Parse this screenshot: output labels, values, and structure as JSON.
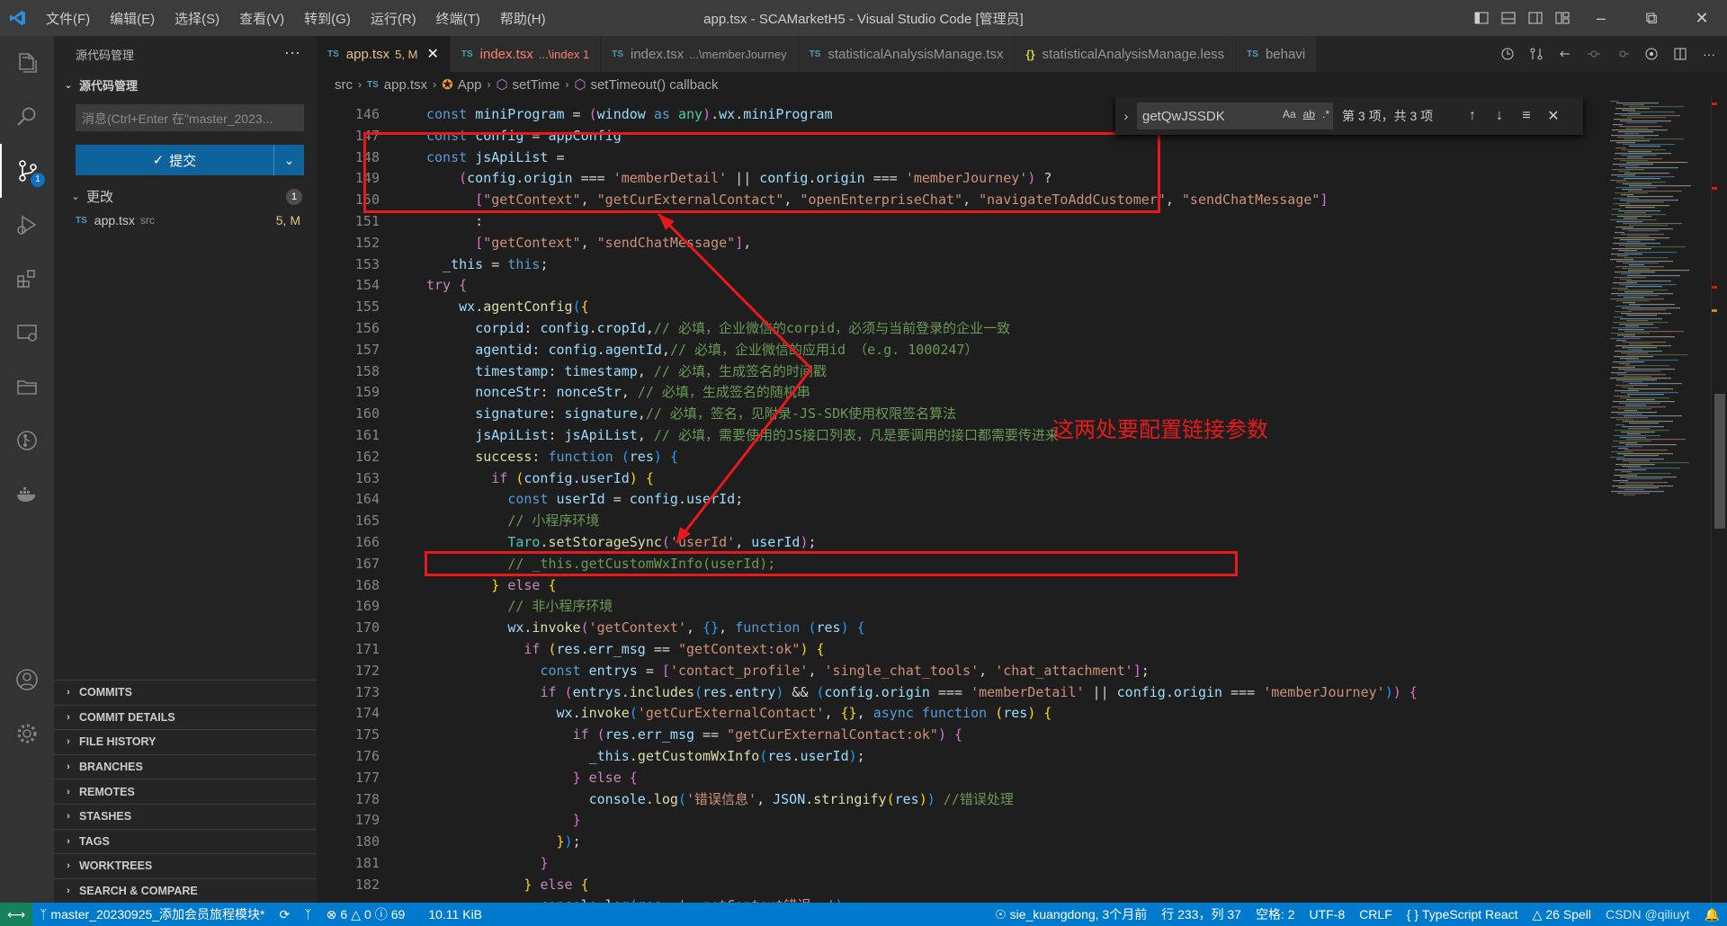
{
  "titlebar": {
    "menu": [
      "文件(F)",
      "编辑(E)",
      "选择(S)",
      "查看(V)",
      "转到(G)",
      "运行(R)",
      "终端(T)",
      "帮助(H)"
    ],
    "title": "app.tsx - SCAMarketH5 - Visual Studio Code [管理员]"
  },
  "activitybar": {
    "icons": [
      "explorer-icon",
      "search-icon",
      "source-control-icon",
      "run-debug-icon",
      "extensions-icon",
      "remote-explorer-icon",
      "folder-icon",
      "git-graph-icon",
      "docker-icon",
      "account-icon",
      "settings-gear-icon"
    ],
    "scm_badge": "1"
  },
  "sidebar": {
    "header": "源代码管理",
    "section": "源代码管理",
    "message_placeholder": "消息(Ctrl+Enter 在\"master_2023...",
    "commit_label": "提交",
    "changes_label": "更改",
    "changes_count": "1",
    "file": {
      "name": "app.tsx",
      "dir": "src",
      "status": "5, M"
    },
    "bottom_sections": [
      "COMMITS",
      "COMMIT DETAILS",
      "FILE HISTORY",
      "BRANCHES",
      "REMOTES",
      "STASHES",
      "TAGS",
      "WORKTREES",
      "SEARCH & COMPARE"
    ]
  },
  "tabs": [
    {
      "icon": "TS",
      "label": "app.tsx",
      "decoration": "5, M",
      "active": true
    },
    {
      "icon": "TS",
      "label": "index.tsx",
      "decoration": "...\\index 1",
      "error": true
    },
    {
      "icon": "TS",
      "label": "index.tsx",
      "decoration": "...\\memberJourney"
    },
    {
      "icon": "TS",
      "label": "statisticalAnalysisManage.tsx",
      "decoration": ""
    },
    {
      "icon": "{}",
      "label": "statisticalAnalysisManage.less",
      "decoration": ""
    },
    {
      "icon": "TS",
      "label": "behavi",
      "decoration": ""
    }
  ],
  "breadcrumb": [
    "src",
    "app.tsx",
    "App",
    "setTime",
    "setTimeout() callback"
  ],
  "find": {
    "query": "getQwJSSDK",
    "options": [
      "Aa",
      "ab",
      ".*"
    ],
    "result": "第 3 项，共 3 项"
  },
  "annotation": "这两处要配置链接参数",
  "line_numbers": [
    "146",
    "147",
    "148",
    "149",
    "150",
    "151",
    "152",
    "153",
    "154",
    "155",
    "156",
    "157",
    "158",
    "159",
    "160",
    "161",
    "162",
    "163",
    "164",
    "165",
    "166",
    "167",
    "168",
    "169",
    "170",
    "171",
    "172",
    "173",
    "174",
    "175",
    "176",
    "177",
    "178",
    "179",
    "180",
    "181",
    "182"
  ],
  "statusbar": {
    "branch": "master_20230925_添加会员旅程模块*",
    "problems": "6",
    "warnings": "0",
    "infos": "69",
    "size": "10.11 KiB",
    "blame": "sie_kuangdong, 3个月前",
    "position": "行 233，列 37",
    "spaces": "空格: 2",
    "encoding": "UTF-8",
    "eol": "CRLF",
    "language": "TypeScript React",
    "spell": "26 Spell",
    "watermark": "CSDN @qiliuyt"
  }
}
